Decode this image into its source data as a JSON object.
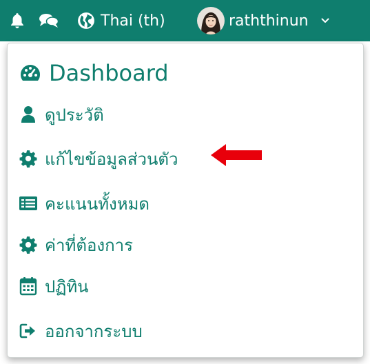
{
  "navbar": {
    "background": "#0f7e6e",
    "icons": [
      "bell-icon",
      "chat-icon",
      "globe-icon"
    ],
    "language_label": "Thai (th)",
    "username": "raththinun",
    "caret_icon": "chevron-down-icon"
  },
  "menu": {
    "accent_color": "#0f7e6e",
    "items": [
      {
        "label": "Dashboard",
        "icon": "dashboard-icon"
      },
      {
        "label": "ดูประวัติ",
        "icon": "user-icon"
      },
      {
        "label": "แก้ไขข้อมูลส่วนตัว",
        "icon": "gear-icon"
      },
      {
        "label": "คะแนนทั้งหมด",
        "icon": "grades-list-icon"
      },
      {
        "label": "ค่าที่ต้องการ",
        "icon": "gear-icon"
      },
      {
        "label": "ปฏิทิน",
        "icon": "calendar-icon"
      },
      {
        "label": "ออกจากระบบ",
        "icon": "logout-icon"
      }
    ]
  },
  "annotation": {
    "arrow_color": "#e8000b",
    "points_to": "แก้ไขข้อมูลส่วนตัว"
  }
}
